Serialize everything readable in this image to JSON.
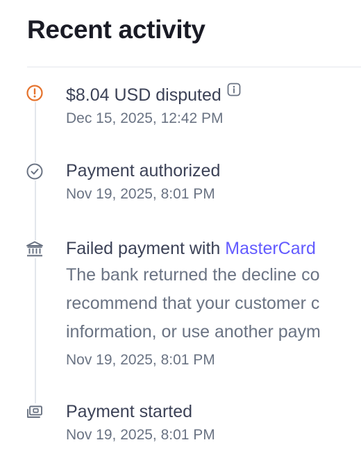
{
  "header": {
    "title": "Recent activity"
  },
  "colors": {
    "warning": "#e5732d",
    "link": "#635bff",
    "icon_gray": "#6a7383",
    "text_primary": "#3c4257",
    "text_secondary": "#6a7383"
  },
  "events": [
    {
      "icon": "alert-circle-icon",
      "title": "$8.04 USD disputed",
      "has_info_icon": true,
      "time": "Dec 15, 2025, 12:42 PM"
    },
    {
      "icon": "check-circle-icon",
      "title": "Payment authorized",
      "time": "Nov 19, 2025, 8:01 PM"
    },
    {
      "icon": "bank-icon",
      "title_prefix": "Failed payment with ",
      "title_link": "MasterCard",
      "description_lines": [
        "The bank returned the decline co",
        "recommend that your customer c",
        "information, or use another paym"
      ],
      "time": "Nov 19, 2025, 8:01 PM"
    },
    {
      "icon": "payment-icon",
      "title": "Payment started",
      "time": "Nov 19, 2025, 8:01 PM"
    }
  ]
}
